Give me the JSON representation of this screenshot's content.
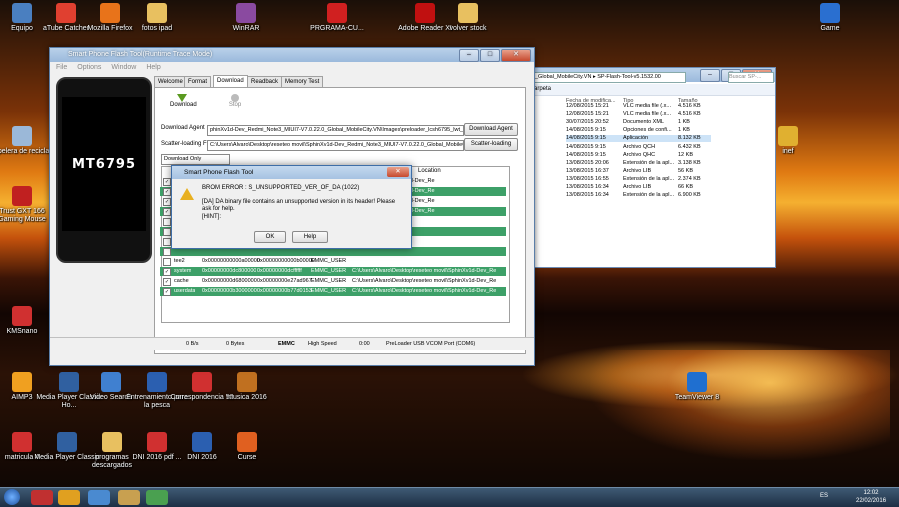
{
  "desktop": {
    "icons_top": [
      {
        "label": "Equipo",
        "icon": "computer-icon",
        "color": "#4a7fc0"
      },
      {
        "label": "aTube Catcher",
        "icon": "atube-icon",
        "color": "#e04030"
      },
      {
        "label": "Mozilla Firefox",
        "icon": "firefox-icon",
        "color": "#e8731a"
      },
      {
        "label": "fotos ipad",
        "icon": "folder-icon",
        "color": "#e8c060"
      },
      {
        "label": "WinRAR",
        "icon": "winrar-icon",
        "color": "#8a4aa0"
      },
      {
        "label": "PRGRAMA-CU...",
        "icon": "pdf-icon",
        "color": "#d02020"
      },
      {
        "label": "Adobe Reader XI",
        "icon": "adobe-icon",
        "color": "#c01010"
      },
      {
        "label": "volver stock",
        "icon": "folder-icon",
        "color": "#e8c060"
      },
      {
        "label": "Game",
        "icon": "game-icon",
        "color": "#2a6fd0"
      }
    ],
    "icons_left": [
      {
        "label": "Papelera de reciclaje",
        "icon": "recycle-bin-icon",
        "color": "#9bb8d8"
      },
      {
        "label": "Trust GXT 166 Gaming Mouse",
        "icon": "mouse-icon",
        "color": "#c02020"
      },
      {
        "label": "KMSnano",
        "icon": "kms-icon",
        "color": "#d03030"
      },
      {
        "label": "AIMP3",
        "icon": "aimp-icon",
        "color": "#f0a020"
      }
    ],
    "icons_bottom1": [
      {
        "label": "Media Player Classic Ho...",
        "icon": "media-player-icon",
        "color": "#3060a0"
      },
      {
        "label": "Video Search",
        "icon": "video-search-icon",
        "color": "#4080d0"
      },
      {
        "label": "Entrenamiento para la pesca",
        "icon": "word-doc-icon",
        "color": "#2b5fb0"
      },
      {
        "label": "Correspondencia 52",
        "icon": "pdf-doc-icon",
        "color": "#d03030"
      },
      {
        "label": "musica 2016",
        "icon": "music-icon",
        "color": "#c07020"
      }
    ],
    "icons_bottom2": [
      {
        "label": "matricula 4",
        "icon": "pdf-doc-icon",
        "color": "#d03030"
      },
      {
        "label": "Media Player Classic",
        "icon": "media-player-icon",
        "color": "#3060a0"
      },
      {
        "label": "programas descargados",
        "icon": "folder-icon",
        "color": "#e8c060"
      },
      {
        "label": "DNI 2016 pdf ...",
        "icon": "pdf-doc-icon",
        "color": "#d03030"
      },
      {
        "label": "DNI 2016",
        "icon": "word-doc-icon",
        "color": "#2b5fb0"
      },
      {
        "label": "Curse",
        "icon": "curse-icon",
        "color": "#e06020"
      }
    ],
    "right_icon_mid": {
      "label": "inef",
      "icon": "key-icon",
      "color": "#e0b030"
    },
    "right_icon_low": {
      "label": "TeamViewer 8",
      "icon": "teamviewer-icon",
      "color": "#1f6fd0"
    }
  },
  "flash_tool": {
    "title": "Smart Phone Flash Tool(Runtime Trace Mode)",
    "menu": [
      "File",
      "Options",
      "Window",
      "Help"
    ],
    "phone_brand": "MT6795",
    "tabs": [
      "Welcome",
      "Format",
      "Download",
      "Readback",
      "Memory Test"
    ],
    "download_label": "Download",
    "stop_label": "Stop",
    "download_agent_label": "Download Agent",
    "download_agent_path": "phinXv1d-Dev_Redmi_Note3_MIUI7-V7.0.22.0_Global_MobileCity.VN\\Images\\preloader_lcsh6795_lwt_l-sign.bin",
    "download_agent_btn": "Download Agent",
    "scatter_label": "Scatter-loading File",
    "scatter_path": "C:\\Users\\Alvaro\\Desktop\\reseteo movil\\SphinXv1d-Dev_Redmi_Note3_MIUI7-V7.0.22.0_Global_MobileCity.VN",
    "scatter_btn": "Scatter-loading",
    "mode": "Download Only",
    "location_header": "Location",
    "rows": [
      {
        "name": "",
        "begin": "",
        "end": "",
        "region": "",
        "location": "reseteo movil\\SphinXv1d-Dev_Re",
        "green": false,
        "checked": true
      },
      {
        "name": "",
        "begin": "",
        "end": "",
        "region": "",
        "location": "reseteo movil\\SphinXv1d-Dev_Re",
        "green": true,
        "checked": true
      },
      {
        "name": "",
        "begin": "",
        "end": "",
        "region": "",
        "location": "reseteo movil\\SphinXv1d-Dev_Re",
        "green": false,
        "checked": true
      },
      {
        "name": "",
        "begin": "",
        "end": "",
        "region": "",
        "location": "reseteo movil\\SphinXv1d-Dev_Re",
        "green": true,
        "checked": true
      },
      {
        "name": "",
        "begin": "",
        "end": "",
        "region": "",
        "location": "",
        "green": false,
        "checked": false
      },
      {
        "name": "",
        "begin": "",
        "end": "",
        "region": "",
        "location": "",
        "green": true,
        "checked": false
      },
      {
        "name": "",
        "begin": "",
        "end": "",
        "region": "",
        "location": "",
        "green": false,
        "checked": false
      },
      {
        "name": "",
        "begin": "",
        "end": "",
        "region": "",
        "location": "",
        "green": true,
        "checked": false
      },
      {
        "name": "tee2",
        "begin": "0x00000000000a00000",
        "end": "0x00000000000b00000",
        "region": "EMMC_USER",
        "location": "",
        "green": false,
        "checked": false
      },
      {
        "name": "system",
        "begin": "0x00000000dc800000",
        "end": "0x00000000dcffffff",
        "region": "EMMC_USER",
        "location": "C:\\Users\\Alvaro\\Desktop\\reseteo movil\\SphinXv1d-Dev_Re",
        "green": true,
        "checked": true
      },
      {
        "name": "cache",
        "begin": "0x00000000d6800000",
        "end": "0x00000000e27ad967",
        "region": "EMMC_USER",
        "location": "C:\\Users\\Alvaro\\Desktop\\reseteo movil\\SphinXv1d-Dev_Re",
        "green": false,
        "checked": true
      },
      {
        "name": "userdata",
        "begin": "0x00000000b3000000",
        "end": "0x00000000b77d0153",
        "region": "EMMC_USER",
        "location": "C:\\Users\\Alvaro\\Desktop\\reseteo movil\\SphinXv1d-Dev_Re",
        "green": true,
        "checked": true
      }
    ],
    "status": {
      "speed": "0 B/s",
      "bytes": "0 Bytes",
      "storage": "EMMC",
      "usb": "High Speed",
      "time": "0:00",
      "port": "PreLoader USB VCOM Port (COM6)"
    }
  },
  "dialog": {
    "title": "Smart Phone Flash Tool",
    "error": "BROM ERROR : S_UNSUPPORTED_VER_OF_DA (1022)",
    "message": "[DA] DA binary file contains an unsupported version in its header! Please ask for help.",
    "hint": "[HINT]:",
    "ok": "OK",
    "help": "Help"
  },
  "explorer": {
    "path": "_Global_MobileCity.VN  ▸  SP-Flash-Tool-v5.1532.00",
    "search": "Buscar SP-...",
    "folder_label": "arpeta",
    "col_date": "Fecha de modifica...",
    "col_type": "Tipo",
    "col_size": "Tamaño",
    "rows": [
      {
        "date": "12/08/2015 15:21",
        "type": "VLC media file (.x...",
        "size": "4.516 KB",
        "sel": false
      },
      {
        "date": "12/08/2015 15:21",
        "type": "VLC media file (.x...",
        "size": "4.516 KB",
        "sel": false
      },
      {
        "date": "30/07/2015 20:52",
        "type": "Documento XML",
        "size": "1 KB",
        "sel": false
      },
      {
        "date": "14/08/2015 9:15",
        "type": "Opciones de confi...",
        "size": "1 KB",
        "sel": false
      },
      {
        "date": "14/08/2015 9:15",
        "type": "Aplicación",
        "size": "8.132 KB",
        "sel": true
      },
      {
        "date": "14/08/2015 9:15",
        "type": "Archivo QCH",
        "size": "6.432 KB",
        "sel": false
      },
      {
        "date": "14/08/2015 9:15",
        "type": "Archivo QHC",
        "size": "12 KB",
        "sel": false
      },
      {
        "date": "13/08/2015 20:06",
        "type": "Extensión de la apl...",
        "size": "3.138 KB",
        "sel": false
      },
      {
        "date": "13/08/2015 16:37",
        "type": "Archivo LIB",
        "size": "56 KB",
        "sel": false
      },
      {
        "date": "13/08/2015 16:55",
        "type": "Extensión de la apl...",
        "size": "2.374 KB",
        "sel": false
      },
      {
        "date": "13/08/2015 16:34",
        "type": "Archivo LIB",
        "size": "66 KB",
        "sel": false
      },
      {
        "date": "13/08/2015 16:34",
        "type": "Extensión de la apl...",
        "size": "6.900 KB",
        "sel": false
      }
    ]
  },
  "taskbar": {
    "lang": "ES",
    "time": "12:02",
    "date": "22/02/2016"
  }
}
